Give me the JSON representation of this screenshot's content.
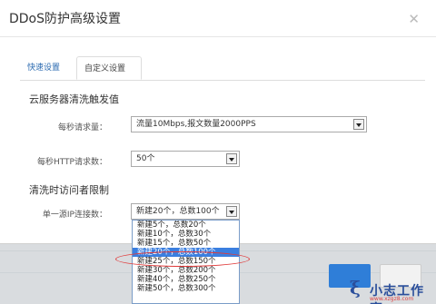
{
  "dialog": {
    "title": "DDoS防护高级设置",
    "close_icon": "close-icon",
    "tabs": [
      {
        "label": "快速设置",
        "active": false
      },
      {
        "label": "自定义设置",
        "active": true
      }
    ]
  },
  "section_trigger": {
    "title": "云服务器清洗触发值",
    "requests_per_second": {
      "label": "每秒请求量：",
      "value": "流量10Mbps,报文数量2000PPS"
    },
    "http_requests_per_second": {
      "label": "每秒HTTP请求数：",
      "value": "50个"
    }
  },
  "section_visitor": {
    "title": "清洗时访问者限制",
    "single_ip_connections": {
      "label": "单一源IP连接数：",
      "value": "新建20个，总数100个",
      "options": [
        "新建5个，总数20个",
        "新建10个，总数30个",
        "新建15个，总数50个",
        "新建20个，总数100个",
        "新建25个，总数150个",
        "新建30个，总数200个",
        "新建40个，总数250个",
        "新建50个，总数300个"
      ],
      "selected_index": 3
    }
  },
  "watermark": {
    "text": "小志工作室",
    "url": "www.xzgz8.com"
  },
  "colors": {
    "accent": "#2f7ed8",
    "tab_active_text": "#2a6ab0",
    "highlight_ring": "#e03b3b",
    "selected_option_bg": "#3b7fe0"
  }
}
